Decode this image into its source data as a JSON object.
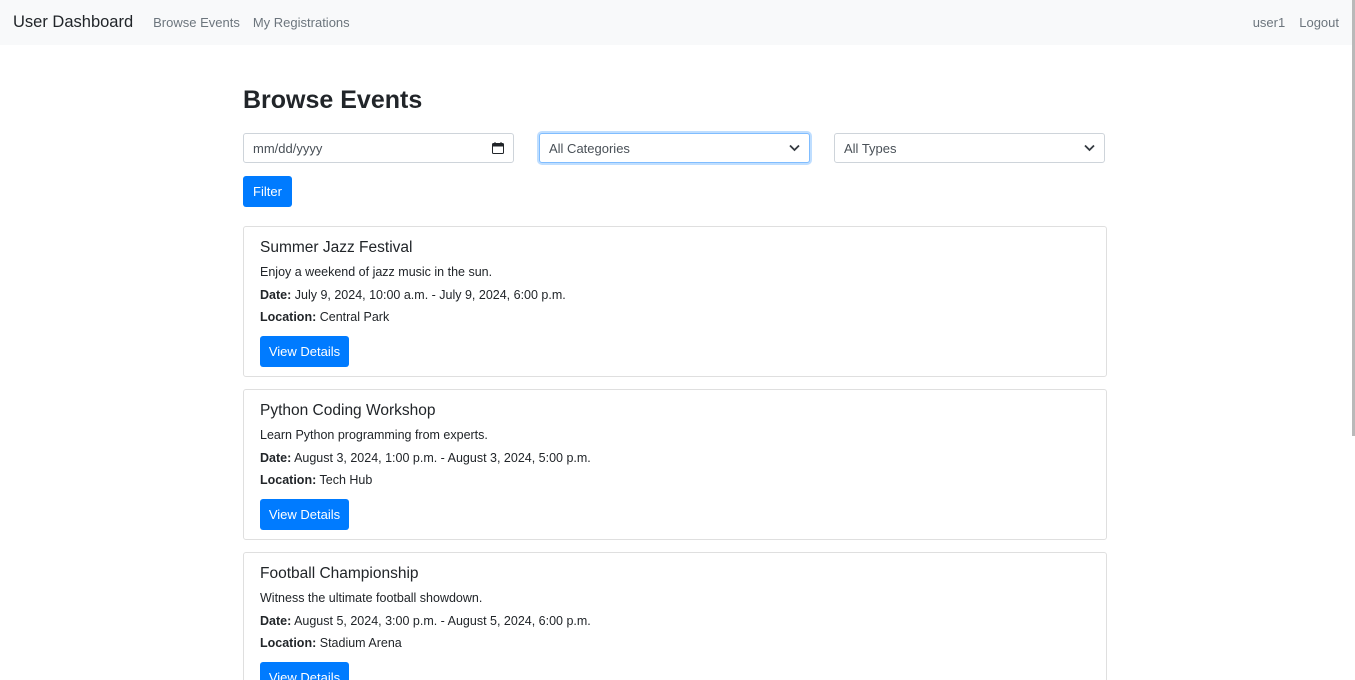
{
  "navbar": {
    "brand": "User Dashboard",
    "links": [
      "Browse Events",
      "My Registrations"
    ],
    "user": "user1",
    "logout": "Logout"
  },
  "page": {
    "title": "Browse Events"
  },
  "filters": {
    "date_placeholder": "mm/dd/yyyy",
    "category_selected": "All Categories",
    "type_selected": "All Types",
    "filter_label": "Filter"
  },
  "labels": {
    "date": "Date:",
    "location": "Location:",
    "view_details": "View Details"
  },
  "events": [
    {
      "title": "Summer Jazz Festival",
      "description": "Enjoy a weekend of jazz music in the sun.",
      "date": "July 9, 2024, 10:00 a.m. - July 9, 2024, 6:00 p.m.",
      "location": "Central Park"
    },
    {
      "title": "Python Coding Workshop",
      "description": "Learn Python programming from experts.",
      "date": "August 3, 2024, 1:00 p.m. - August 3, 2024, 5:00 p.m.",
      "location": "Tech Hub"
    },
    {
      "title": "Football Championship",
      "description": "Witness the ultimate football showdown.",
      "date": "August 5, 2024, 3:00 p.m. - August 5, 2024, 6:00 p.m.",
      "location": "Stadium Arena"
    }
  ],
  "colors": {
    "primary": "#007bff",
    "navbar_bg": "#f8f9fa",
    "muted": "#6c757d"
  }
}
